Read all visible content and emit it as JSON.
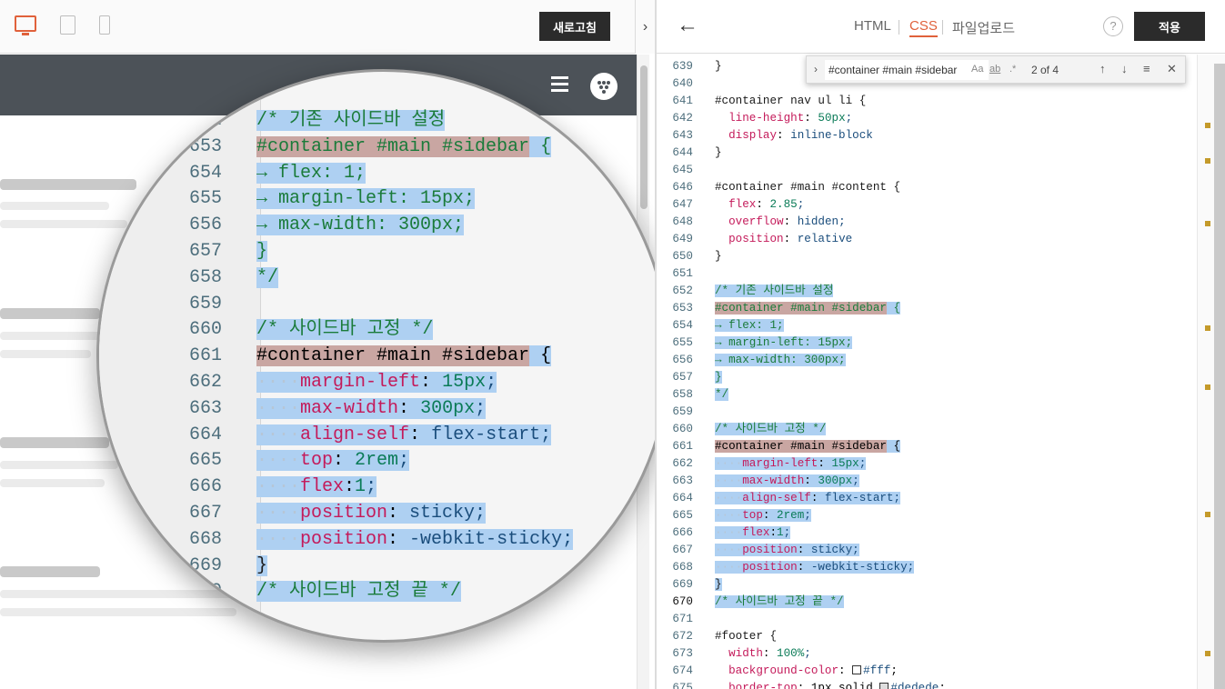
{
  "preview": {
    "devices": [
      "desktop-icon",
      "tablet-icon",
      "mobile-icon"
    ],
    "refresh_label": "새로고침",
    "collapse_glyph": "›"
  },
  "editor_toolbar": {
    "back_glyph": "←",
    "tabs": [
      "HTML",
      "CSS",
      "파일업로드"
    ],
    "active_tab": "CSS",
    "help_glyph": "?",
    "apply_label": "적용"
  },
  "find": {
    "query": "#container #main #sidebar",
    "match_case": "Aa",
    "whole_word": "ab",
    "regex": ".*",
    "count": "2 of 4",
    "prev_glyph": "↑",
    "next_glyph": "↓",
    "selection_glyph": "≡",
    "close_glyph": "✕"
  },
  "code": [
    {
      "n": "639",
      "t": "}"
    },
    {
      "n": "640",
      "t": ""
    },
    {
      "n": "641",
      "t": "#container nav ul li {"
    },
    {
      "n": "642",
      "t": "  line-height: 50px;"
    },
    {
      "n": "643",
      "t": "  display: inline-block"
    },
    {
      "n": "644",
      "t": "}"
    },
    {
      "n": "645",
      "t": ""
    },
    {
      "n": "646",
      "t": "#container #main #content {"
    },
    {
      "n": "647",
      "t": "  flex: 2.85;"
    },
    {
      "n": "648",
      "t": "  overflow: hidden;"
    },
    {
      "n": "649",
      "t": "  position: relative"
    },
    {
      "n": "650",
      "t": "}"
    },
    {
      "n": "651",
      "t": ""
    },
    {
      "n": "652",
      "t": "/* 기존 사이드바 설정"
    },
    {
      "n": "653",
      "t": "#container #main #sidebar {"
    },
    {
      "n": "654",
      "t": "→ flex: 1;"
    },
    {
      "n": "655",
      "t": "→ margin-left: 15px;"
    },
    {
      "n": "656",
      "t": "→ max-width: 300px;"
    },
    {
      "n": "657",
      "t": "}"
    },
    {
      "n": "658",
      "t": "*/"
    },
    {
      "n": "659",
      "t": ""
    },
    {
      "n": "660",
      "t": "/* 사이드바 고정 */"
    },
    {
      "n": "661",
      "t": "#container #main #sidebar {"
    },
    {
      "n": "662",
      "t": "····margin-left: 15px;"
    },
    {
      "n": "663",
      "t": "····max-width: 300px;"
    },
    {
      "n": "664",
      "t": "····align-self: flex-start;"
    },
    {
      "n": "665",
      "t": "····top: 2rem;"
    },
    {
      "n": "666",
      "t": "····flex:1;"
    },
    {
      "n": "667",
      "t": "····position: sticky;"
    },
    {
      "n": "668",
      "t": "····position: -webkit-sticky;"
    },
    {
      "n": "669",
      "t": "}"
    },
    {
      "n": "670",
      "t": "/* 사이드바 고정 끝 */"
    },
    {
      "n": "671",
      "t": ""
    },
    {
      "n": "672",
      "t": "#footer {"
    },
    {
      "n": "673",
      "t": "  width: 100%;"
    },
    {
      "n": "674",
      "t": "  background-color: #fff;"
    },
    {
      "n": "675",
      "t": "  border-top: 1px solid #dedede;"
    }
  ],
  "magnified": [
    {
      "n": "652",
      "t": "/* 기존 사이드바 설정"
    },
    {
      "n": "653",
      "t": "#container #main #sidebar {"
    },
    {
      "n": "654",
      "t": "→ flex: 1;"
    },
    {
      "n": "655",
      "t": "→ margin-left: 15px;"
    },
    {
      "n": "656",
      "t": "→ max-width: 300px;"
    },
    {
      "n": "657",
      "t": "}"
    },
    {
      "n": "658",
      "t": "*/"
    },
    {
      "n": "659",
      "t": ""
    },
    {
      "n": "660",
      "t": "/* 사이드바 고정 */"
    },
    {
      "n": "661",
      "t": "#container #main #sidebar {"
    },
    {
      "n": "662",
      "t": "····margin-left: 15px;"
    },
    {
      "n": "663",
      "t": "····max-width: 300px;"
    },
    {
      "n": "664",
      "t": "····align-self: flex-start;"
    },
    {
      "n": "665",
      "t": "····top: 2rem;"
    },
    {
      "n": "666",
      "t": "····flex:1;"
    },
    {
      "n": "667",
      "t": "····position: sticky;"
    },
    {
      "n": "668",
      "t": "····position: -webkit-sticky;"
    },
    {
      "n": "669",
      "t": "}"
    },
    {
      "n": "670",
      "t": "/* 사이드바 고정 끝 */"
    }
  ],
  "colors": {
    "accent": "#e0613b",
    "selection": "#aed0f2",
    "match": "#c9a6a2",
    "header_bg": "#4c5258",
    "button_bg": "#2b2b2b"
  }
}
